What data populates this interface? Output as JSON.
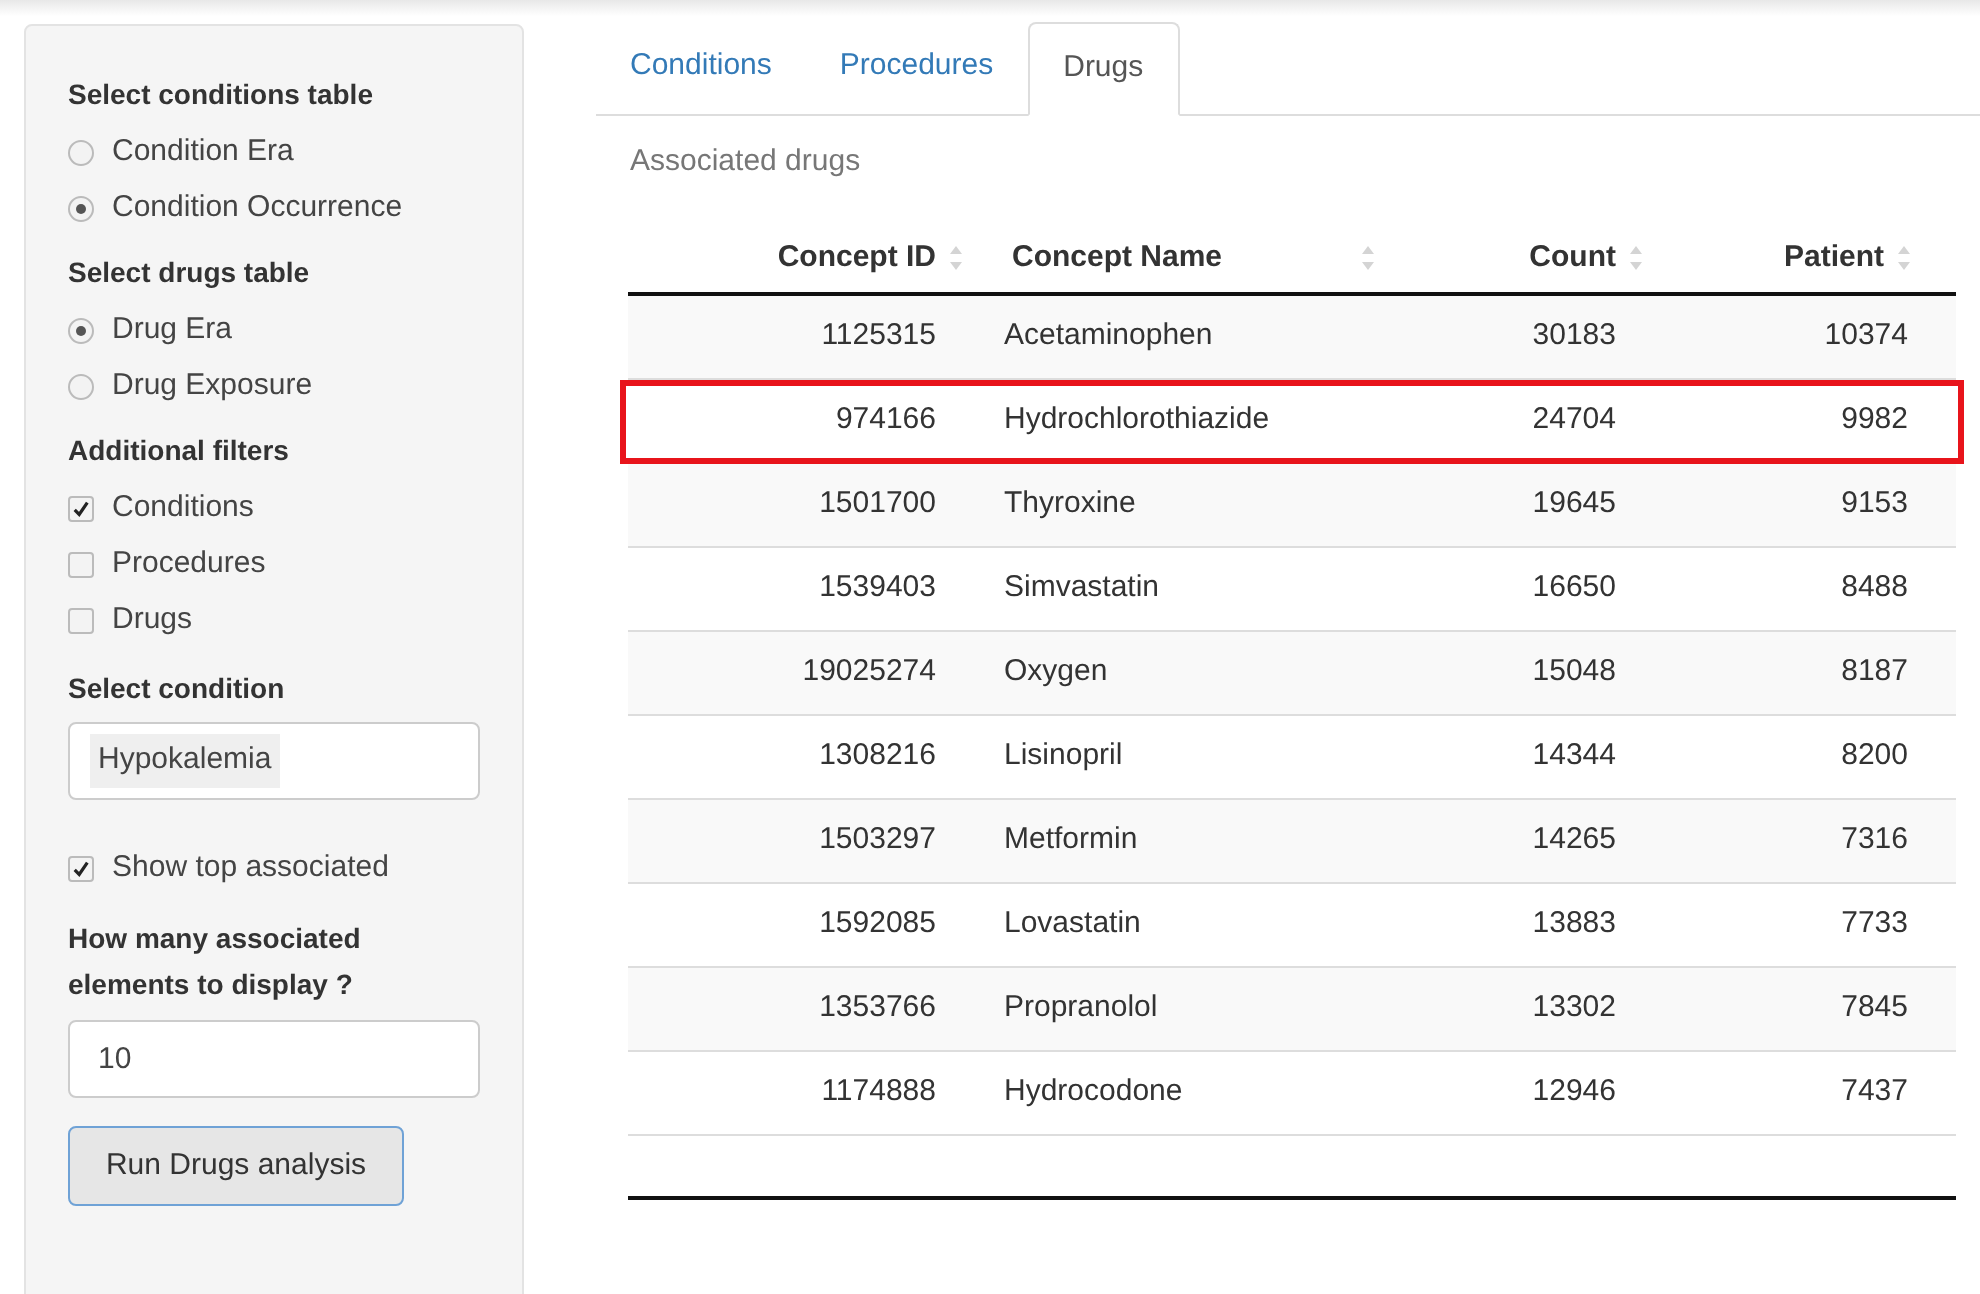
{
  "sidebar": {
    "sections": [
      {
        "kind": "radio",
        "title": "Select conditions table",
        "options": [
          {
            "label": "Condition Era",
            "selected": false
          },
          {
            "label": "Condition Occurrence",
            "selected": true
          }
        ]
      },
      {
        "kind": "radio",
        "title": "Select drugs table",
        "options": [
          {
            "label": "Drug Era",
            "selected": true
          },
          {
            "label": "Drug Exposure",
            "selected": false
          }
        ]
      },
      {
        "kind": "checkbox",
        "title": "Additional filters",
        "options": [
          {
            "label": "Conditions",
            "checked": true
          },
          {
            "label": "Procedures",
            "checked": false
          },
          {
            "label": "Drugs",
            "checked": false
          }
        ]
      }
    ],
    "condition": {
      "label": "Select condition",
      "value": "Hypokalemia"
    },
    "show_top": {
      "label": "Show top associated",
      "checked": true
    },
    "count": {
      "label": "How many associated elements to display ?",
      "value": "10"
    },
    "run_button": "Run Drugs analysis"
  },
  "tabs": [
    {
      "label": "Conditions",
      "selected": false
    },
    {
      "label": "Procedures",
      "selected": false
    },
    {
      "label": "Drugs",
      "selected": true
    }
  ],
  "table": {
    "caption": "Associated drugs",
    "columns": [
      "Concept ID",
      "Concept Name",
      "Count",
      "Patient"
    ],
    "rows": [
      {
        "cells": [
          "1125315",
          "Acetaminophen",
          "30183",
          "10374"
        ],
        "highlighted": false
      },
      {
        "cells": [
          "974166",
          "Hydrochlorothiazide",
          "24704",
          "9982"
        ],
        "highlighted": true
      },
      {
        "cells": [
          "1501700",
          "Thyroxine",
          "19645",
          "9153"
        ],
        "highlighted": false
      },
      {
        "cells": [
          "1539403",
          "Simvastatin",
          "16650",
          "8488"
        ],
        "highlighted": false
      },
      {
        "cells": [
          "19025274",
          "Oxygen",
          "15048",
          "8187"
        ],
        "highlighted": false
      },
      {
        "cells": [
          "1308216",
          "Lisinopril",
          "14344",
          "8200"
        ],
        "highlighted": false
      },
      {
        "cells": [
          "1503297",
          "Metformin",
          "14265",
          "7316"
        ],
        "highlighted": false
      },
      {
        "cells": [
          "1592085",
          "Lovastatin",
          "13883",
          "7733"
        ],
        "highlighted": false
      },
      {
        "cells": [
          "1353766",
          "Propranolol",
          "13302",
          "7845"
        ],
        "highlighted": false
      },
      {
        "cells": [
          "1174888",
          "Hydrocodone",
          "12946",
          "7437"
        ],
        "highlighted": false
      }
    ]
  }
}
